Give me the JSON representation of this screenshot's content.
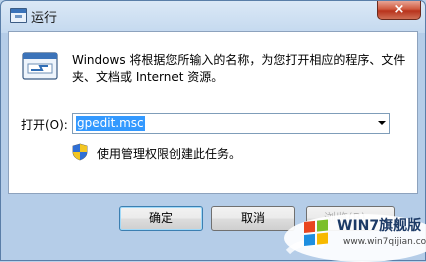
{
  "window": {
    "title": "运行",
    "close_label": "×"
  },
  "description": "Windows 将根据您所输入的名称，为您打开相应的程序、文件夹、文档或 Internet 资源。",
  "open_field": {
    "label": "打开(O):",
    "value": "gpedit.msc"
  },
  "admin_note": "使用管理权限创建此任务。",
  "buttons": {
    "ok": "确定",
    "cancel": "取消",
    "browse": "浏览(B)..."
  },
  "watermark": {
    "brand": "WIN7旗舰版",
    "url": "www.win7qijian.com"
  }
}
